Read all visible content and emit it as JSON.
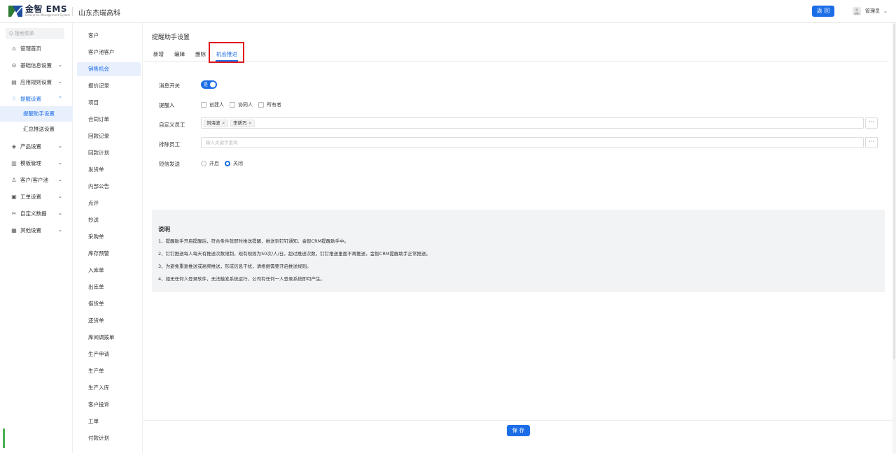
{
  "header": {
    "logo_text": "金智 EMS",
    "logo_sub": "Enterprise Management System",
    "company": "山东杰瑞高科",
    "back_label": "返 回",
    "user_name": "管理员",
    "user_caret": "⌄"
  },
  "sidebar": {
    "search_placeholder": "Q 搜索菜单",
    "items": [
      {
        "label": "管理首页",
        "icon": "⌂"
      },
      {
        "label": "基础信息设置",
        "icon": "⊙",
        "caret": "⌄"
      },
      {
        "label": "应用规则设置",
        "icon": "▤",
        "caret": "⌄"
      },
      {
        "label": "提醒设置",
        "icon": "♢",
        "caret": "⌃"
      },
      {
        "label": "产品设置",
        "icon": "◈",
        "caret": "⌄"
      },
      {
        "label": "模板管理",
        "icon": "▥",
        "caret": "⌄"
      },
      {
        "label": "客户/客户池",
        "icon": "♙",
        "caret": "⌄"
      },
      {
        "label": "工单设置",
        "icon": "▣",
        "caret": "⌄"
      },
      {
        "label": "自定义数据",
        "icon": "✂",
        "caret": "⌄"
      },
      {
        "label": "其他设置",
        "icon": "▦",
        "caret": "⌄"
      }
    ],
    "sub_items": [
      {
        "label": "提醒助手设置"
      },
      {
        "label": "汇总推送设置"
      }
    ]
  },
  "subnav": {
    "items": [
      "客户",
      "客户池客户",
      "销售机会",
      "报价记录",
      "项目",
      "合同订单",
      "回款记录",
      "回款计划",
      "发货单",
      "内部公告",
      "点评",
      "抄送",
      "采购单",
      "库存预警",
      "入库单",
      "出库单",
      "借货单",
      "还货单",
      "库间调拨单",
      "生产申请",
      "生产单",
      "生产入库",
      "客户投诉",
      "工单",
      "付款计划"
    ]
  },
  "main": {
    "title": "提醒助手设置",
    "tabs": [
      "新增",
      "编辑",
      "删除",
      "机会推进"
    ],
    "form": {
      "switch_label": "消息开关",
      "switch_text": "是",
      "reminder_label": "提醒人",
      "reminder_options": [
        "创建人",
        "协同人",
        "所有者"
      ],
      "custom_label": "自定义员工",
      "custom_tags": [
        "刘海波",
        "李新巧"
      ],
      "exclude_label": "排除员工",
      "exclude_placeholder": "输入关键字查询",
      "sms_label": "短信发送",
      "sms_options": [
        "开启",
        "关闭"
      ],
      "sms_selected": "关闭",
      "dots": "···"
    },
    "notes": {
      "title": "说明",
      "lines": [
        "1、提醒助手开启提醒后，符合条件就即时推送提醒，推送到钉钉通知、金智CRM提醒助手中。",
        "2、钉钉推送每人每天有推送次数限制，现有规则为50次/人/日。超过推送次数，钉钉推送里面不再推送，金智CRM提醒助手正常推送。",
        "3、为避免重复推送或高频推送，形成信息干扰，请根据需要开启推送规则。",
        "4、如无任何人登录软件，无法触发系统运行，公司有任何一人登录系统即可产生。"
      ]
    },
    "save_label": "保 存"
  },
  "colors": {
    "accent": "#1c6de8",
    "highlight": "#e0191b"
  }
}
